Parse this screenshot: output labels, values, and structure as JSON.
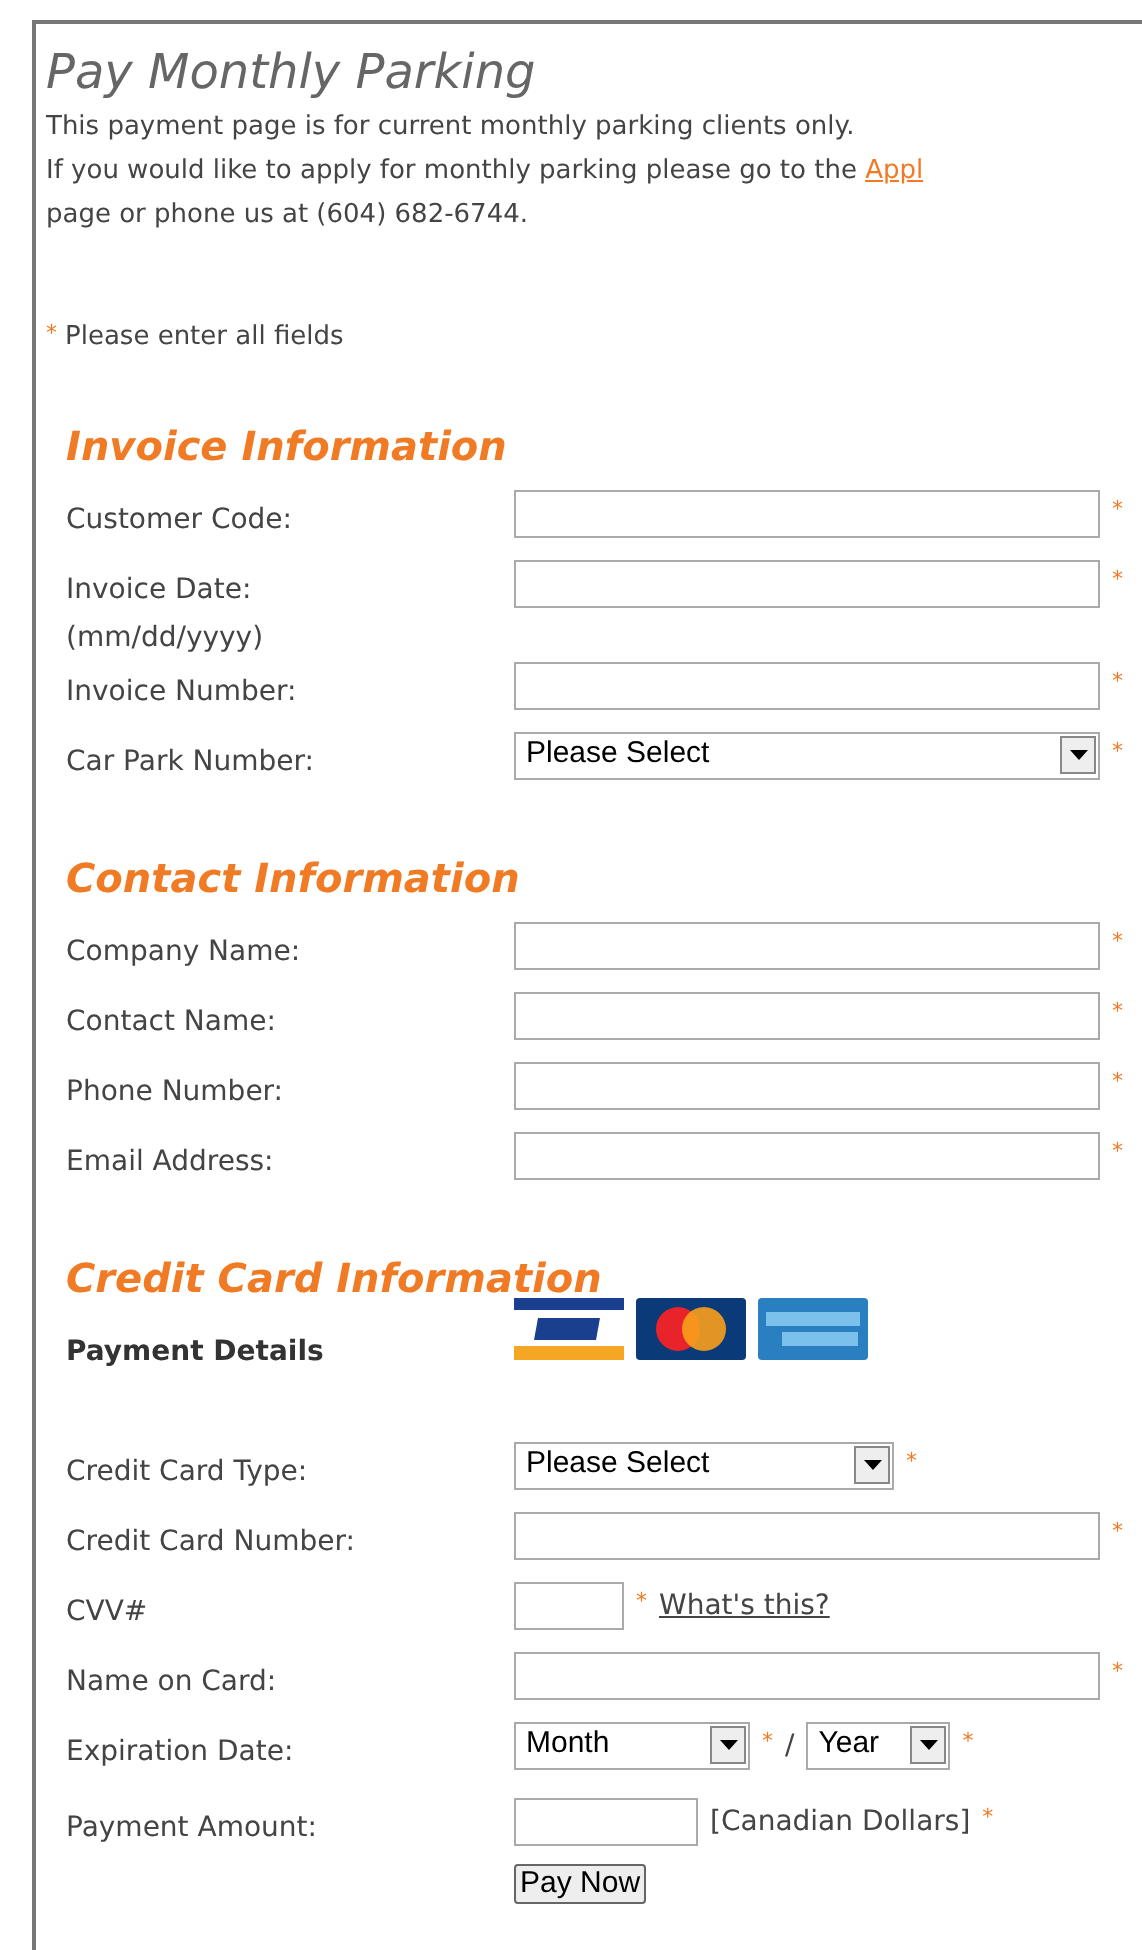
{
  "title": "Pay Monthly Parking",
  "intro": [
    {
      "text": "This payment page is for current monthly parking clients only."
    },
    {
      "text": "If you would like to apply for monthly parking please go to the ",
      "link": "Appl"
    },
    {
      "text": "page or phone us at (604) 682-6744."
    }
  ],
  "note": {
    "mark": "*",
    "text": "Please enter all fields"
  },
  "sections": [
    {
      "heading": "Invoice Information",
      "rows": [
        {
          "kind": "text",
          "label": "Customer Code:",
          "mark": "*"
        },
        {
          "kind": "text",
          "label": "Invoice Date:",
          "sublabel": "(mm/dd/yyyy)",
          "mark": "*"
        },
        {
          "kind": "text",
          "label": "Invoice Number:",
          "mark": "*"
        },
        {
          "kind": "select",
          "label": "Car Park Number:",
          "value": "Please Select",
          "mark": "*"
        }
      ]
    },
    {
      "heading": "Contact Information",
      "rows": [
        {
          "kind": "text",
          "label": "Company Name:",
          "mark": "*"
        },
        {
          "kind": "text",
          "label": "Contact Name:",
          "mark": "*"
        },
        {
          "kind": "text",
          "label": "Phone Number:",
          "mark": "*"
        },
        {
          "kind": "text",
          "label": "Email Address:",
          "mark": "*"
        }
      ]
    },
    {
      "heading": "Credit Card Information",
      "rows": [
        {
          "kind": "cards",
          "label": "Payment Details"
        },
        {
          "kind": "type_select",
          "label": "Credit Card Type:",
          "value": "Please Select",
          "mark": "*"
        },
        {
          "kind": "text",
          "label": "Credit Card Number:",
          "mark": "*"
        },
        {
          "kind": "code",
          "label": "CVV#",
          "mark": "*",
          "link": "What's this?"
        },
        {
          "kind": "text",
          "label": "Name on Card:",
          "mark": "*"
        },
        {
          "kind": "expiry",
          "label": "Expiration Date:",
          "selects": [
            {
              "value": "Month",
              "mark": "*"
            },
            {
              "value": "Year",
              "mark": "*"
            }
          ],
          "separator": "/"
        },
        {
          "kind": "amount",
          "label": "Payment Amount:",
          "suffix": "[Canadian Dollars]",
          "mark": "*"
        },
        {
          "kind": "button",
          "label": "Pay Now"
        }
      ]
    }
  ]
}
